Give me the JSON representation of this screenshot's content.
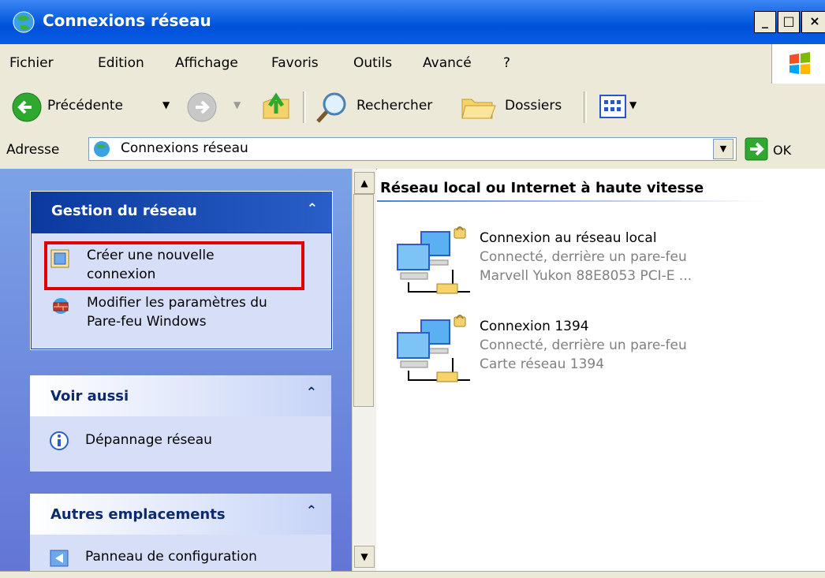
{
  "window": {
    "title": "Connexions réseau",
    "min": "_",
    "max": "□",
    "close": "×"
  },
  "menu": [
    "Fichier",
    "Edition",
    "Affichage",
    "Favoris",
    "Outils",
    "Avancé",
    "?"
  ],
  "toolbar": {
    "back": "Précédente",
    "search": "Rechercher",
    "folders": "Dossiers"
  },
  "address": {
    "label": "Adresse",
    "value": "Connexions réseau",
    "go": "OK"
  },
  "panels": {
    "network": {
      "title": "Gestion du réseau",
      "items": [
        "Créer une nouvelle",
        "connexion",
        "Modifier les paramètres du",
        "Pare-feu Windows"
      ]
    },
    "see_also": {
      "title": "Voir aussi",
      "items": [
        "Dépannage réseau"
      ]
    },
    "other": {
      "title": "Autres emplacements",
      "items": [
        "Panneau de configuration"
      ]
    }
  },
  "content": {
    "group_title": "Réseau local ou Internet à haute vitesse",
    "connections": [
      {
        "name": "Connexion au réseau local",
        "status": "Connecté, derrière un pare-feu",
        "device": "Marvell Yukon 88E8053 PCI-E ..."
      },
      {
        "name": "Connexion 1394",
        "status": "Connecté, derrière un pare-feu",
        "device": "Carte réseau 1394"
      }
    ]
  },
  "colors": {
    "titlebar": "#0054e3",
    "highlight_box": "#e00000",
    "pane_bg": "#7ba2e7",
    "pane_header": "#d6dff7"
  }
}
